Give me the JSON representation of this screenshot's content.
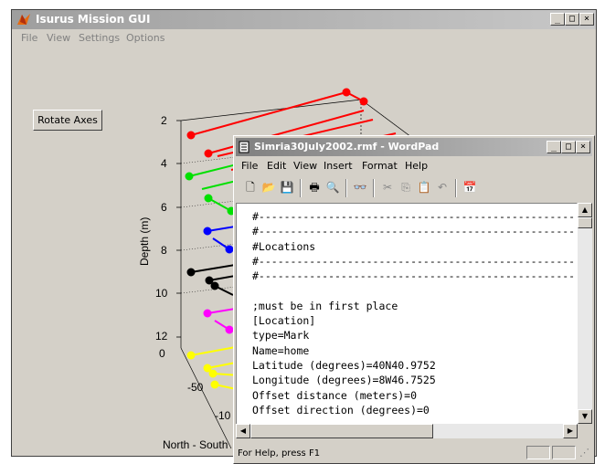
{
  "isurus": {
    "title": "Isurus Mission GUI",
    "menu": [
      "File",
      "View",
      "Settings",
      "Options"
    ],
    "rotate_button": "Rotate Axes",
    "axes": {
      "depth_label": "Depth (m)",
      "depth_ticks": [
        "2",
        "4",
        "6",
        "8",
        "10",
        "12"
      ],
      "ns_label": "North - South",
      "ns_ticks": [
        "0",
        "-50",
        "-10"
      ]
    }
  },
  "wordpad": {
    "title": "Simria30July2002.rmf - WordPad",
    "menu": [
      "File",
      "Edit",
      "View",
      "Insert",
      "Format",
      "Help"
    ],
    "toolbar_icons": [
      "new-icon",
      "open-icon",
      "save-icon",
      "print-icon",
      "print-preview-icon",
      "find-icon",
      "cut-icon",
      "copy-icon",
      "paste-icon",
      "undo-icon",
      "datetime-icon"
    ],
    "lines": [
      "#--------------------------------------------------------",
      "#--------------------------------------------------------",
      "#Locations",
      "#--------------------------------------------------------",
      "#--------------------------------------------------------",
      "",
      ";must be in first place",
      "[Location]",
      "type=Mark",
      "Name=home",
      "Latitude (degrees)=40N40.9752",
      "Longitude (degrees)=8W46.7525",
      "Offset distance (meters)=0",
      "Offset direction (degrees)=0"
    ],
    "status": "For Help, press F1"
  },
  "colors": {
    "red": "#ff0000",
    "green": "#00e000",
    "blue": "#0000ff",
    "black": "#000000",
    "magenta": "#ff00ff",
    "yellow": "#ffff00"
  }
}
